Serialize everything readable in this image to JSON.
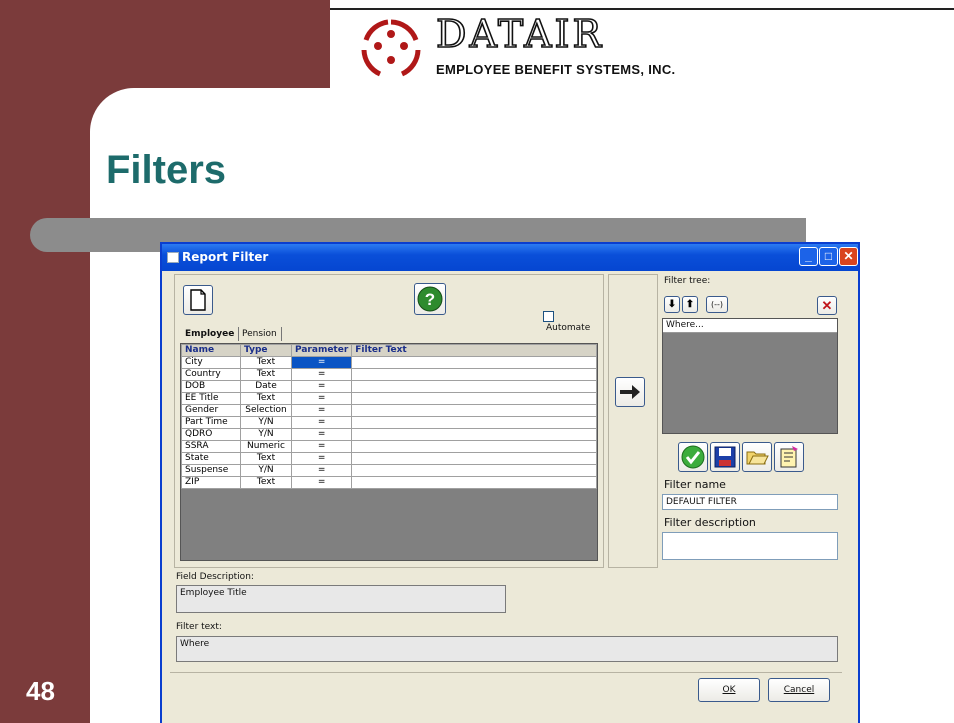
{
  "slide": {
    "title": "Filters",
    "page_number": "48",
    "logo_word": "DATAIR",
    "logo_subtitle": "EMPLOYEE BENEFIT SYSTEMS, INC."
  },
  "window": {
    "title": "Report Filter",
    "title_buttons": [
      "minimize",
      "maximize",
      "close"
    ]
  },
  "left_panel": {
    "automate_label": "Automate",
    "automate_checked": false,
    "tabs": [
      {
        "label": "Employee",
        "active": true
      },
      {
        "label": "Pension",
        "active": false
      }
    ],
    "columns": [
      "Name",
      "Type",
      "Parameter",
      "Filter Text"
    ],
    "rows": [
      {
        "name": "City",
        "type": "Text",
        "param": "=",
        "filter": ""
      },
      {
        "name": "Country",
        "type": "Text",
        "param": "=",
        "filter": ""
      },
      {
        "name": "DOB",
        "type": "Date",
        "param": "=",
        "filter": ""
      },
      {
        "name": "EE Title",
        "type": "Text",
        "param": "=",
        "filter": ""
      },
      {
        "name": "Gender",
        "type": "Selection",
        "param": "=",
        "filter": ""
      },
      {
        "name": "Part Time",
        "type": "Y/N",
        "param": "=",
        "filter": ""
      },
      {
        "name": "QDRO",
        "type": "Y/N",
        "param": "=",
        "filter": ""
      },
      {
        "name": "SSRA",
        "type": "Numeric",
        "param": "=",
        "filter": ""
      },
      {
        "name": "State",
        "type": "Text",
        "param": "=",
        "filter": ""
      },
      {
        "name": "Suspense",
        "type": "Y/N",
        "param": "=",
        "filter": ""
      },
      {
        "name": "ZIP",
        "type": "Text",
        "param": "=",
        "filter": ""
      }
    ]
  },
  "right_panel": {
    "filter_tree_label": "Filter tree:",
    "tree_root": "Where...",
    "paren_label": "(--)",
    "filter_name_label": "Filter name",
    "filter_name_value": "DEFAULT FILTER",
    "filter_description_label": "Filter description",
    "filter_description_value": ""
  },
  "bottom": {
    "field_description_label": "Field Description:",
    "field_description_value": "Employee Title",
    "filter_text_label": "Filter text:",
    "filter_text_value": "Where",
    "ok_label": "OK",
    "cancel_label": "Cancel"
  },
  "colors": {
    "slide_maroon": "#7b3b3b",
    "title_teal": "#1d6b6b",
    "xp_blue": "#0a4fd9",
    "selected_cell": "#0a54c4"
  }
}
